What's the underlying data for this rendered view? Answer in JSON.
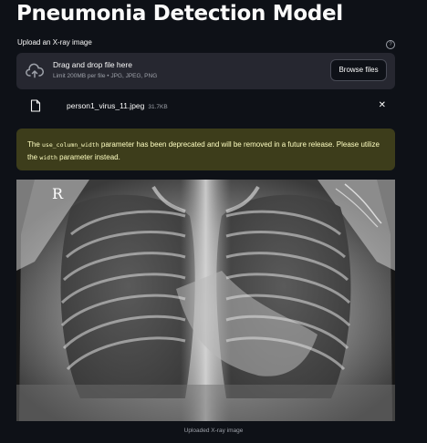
{
  "header": {
    "title": "Pneumonia Detection Model"
  },
  "uploader": {
    "label": "Upload an X-ray image",
    "help_icon": "question-circle-icon",
    "dropzone": {
      "icon": "cloud-upload-icon",
      "main_text": "Drag and drop file here",
      "sub_text": "Limit 200MB per file • JPG, JPEG, PNG",
      "browse_label": "Browse files"
    },
    "file": {
      "icon": "file-icon",
      "name": "person1_virus_11.jpeg",
      "size": "31.7KB",
      "close_icon": "close-icon"
    }
  },
  "warning": {
    "text_1": "The ",
    "code_1": "use_column_width",
    "text_2": " parameter has been deprecated and will be removed in a future release. Please utilize the ",
    "code_2": "width",
    "text_3": " parameter instead."
  },
  "image": {
    "marker": "R",
    "caption": "Uploaded X-ray image"
  },
  "colors": {
    "background": "#0e1117",
    "panel": "#262730",
    "warning_bg": "#3d3d1b",
    "warning_text": "#ffffc2"
  }
}
